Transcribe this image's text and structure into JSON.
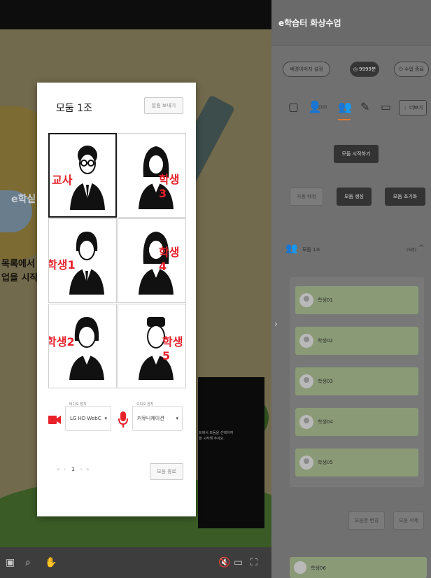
{
  "stage": {
    "logo_text": "e학싵",
    "side_text_1": "목록에서",
    "side_text_2": "업을 시작",
    "slide_text_1": "트에서 모둠을 선택하여",
    "slide_text_2": "을 시작해 주세요."
  },
  "panel": {
    "title": "e학습터 화상수업",
    "bg_image_button": "배경이미지 설정",
    "timer_label": "9999분",
    "end_class_button": "수업 종료",
    "participant_count": "(10)",
    "more_button": "더보기",
    "start_group_button": "모둠 시작하기",
    "auto_assign_button": "자동 배정",
    "create_group_button": "모둠 생성",
    "reset_group_button": "모둠 초기화",
    "group_name": "모둠 1조",
    "group_count": "(5명)",
    "members": [
      "학생01",
      "학생02",
      "학생03",
      "학생04",
      "학생05"
    ],
    "rename_group_button": "모둠명 변경",
    "delete_group_button": "모둠 삭제",
    "extra_member": "학생06"
  },
  "modal": {
    "title": "모둠 1조",
    "notice_button": "알림 보내기",
    "participants": [
      "교사",
      "학생3",
      "학생1",
      "학생4",
      "학생2",
      "학생5"
    ],
    "video_device_label": "비디오 장치",
    "video_device_value": "LG HD WebC",
    "audio_device_label": "오디오 장치",
    "audio_device_value": "커뮤니케이션",
    "pager": {
      "first": "«",
      "prev": "‹",
      "current": "1",
      "next": "›",
      "last": "»"
    },
    "end_group_button": "모둠 종료"
  },
  "colors": {
    "label_red": "#e8212b",
    "active_orange": "#e8772a",
    "member_green": "#8a9a77"
  }
}
